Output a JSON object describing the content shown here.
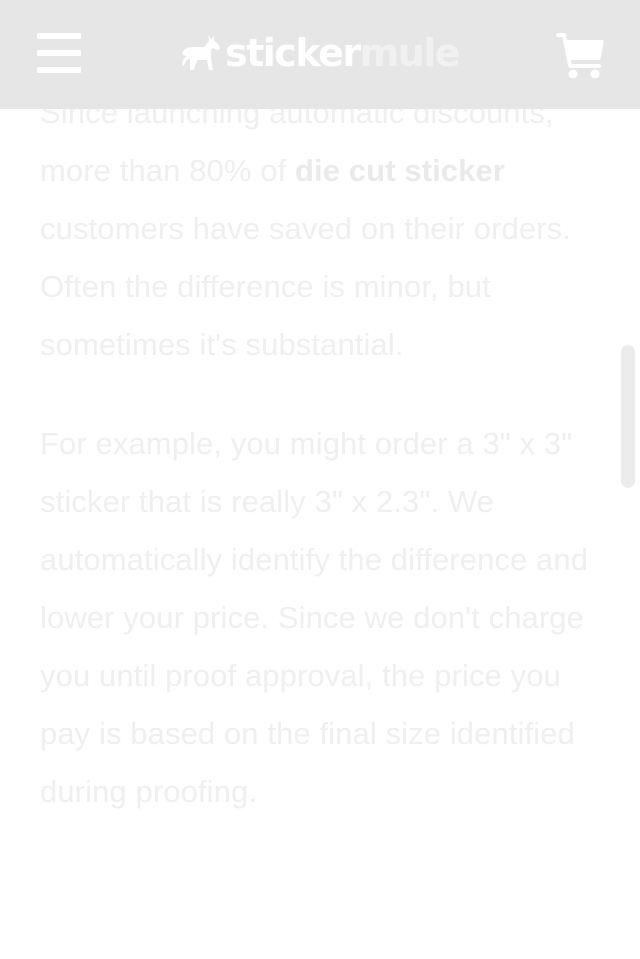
{
  "header": {
    "brand_part1": "sticker",
    "brand_part2": "mule"
  },
  "icons": {
    "menu": "hamburger-menu-icon",
    "logo": "mule-logo-icon",
    "cart": "shopping-cart-icon"
  },
  "article": {
    "p1_intro": "Since launching automatic discounts, more than 80% of ",
    "p1_link": "die cut sticker",
    "p1_rest": " customers have saved on their orders. Often the difference is minor, but sometimes it's substantial.",
    "p2": "For example, you might order a 3\" x 3\" sticker that is really 3\" x 2.3\". We automatically identify the difference and lower your price. Since we don't charge you until proof approval, the price you pay is based on the final size identified during proofing."
  },
  "colors": {
    "header_bg": "#e6e6e6",
    "header_icon": "#ffffff",
    "body_text": "#efefef",
    "page_bg": "#ffffff"
  }
}
